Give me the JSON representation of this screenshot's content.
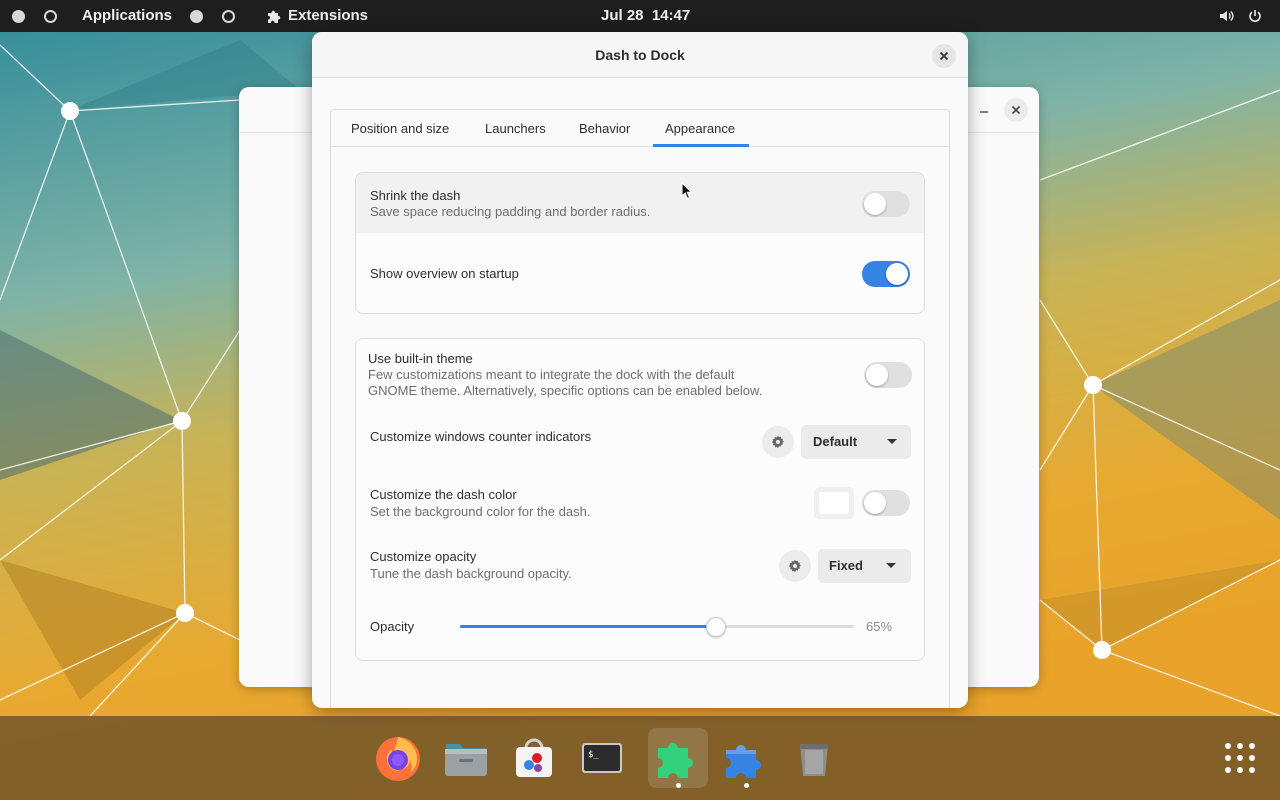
{
  "topbar": {
    "applications_label": "Applications",
    "extensions_label": "Extensions",
    "datetime": "Jul 28  14:47",
    "volume_icon": "volume-icon",
    "power_icon": "power-icon"
  },
  "dialog": {
    "title": "Dash to Dock",
    "tabs": [
      {
        "label": "Position and size"
      },
      {
        "label": "Launchers"
      },
      {
        "label": "Behavior"
      },
      {
        "label": "Appearance",
        "active": true
      }
    ],
    "shrink": {
      "title": "Shrink the dash",
      "subtitle": "Save space reducing padding and border radius.",
      "enabled": false
    },
    "overview": {
      "title": "Show overview on startup",
      "enabled": true
    },
    "builtin_theme": {
      "title": "Use built-in theme",
      "subtitle_line1": "Few customizations meant to integrate the dock with the default",
      "subtitle_line2": "GNOME theme. Alternatively, specific options can be enabled below.",
      "enabled": false
    },
    "counter": {
      "title": "Customize windows counter indicators",
      "value": "Default"
    },
    "dash_color": {
      "title": "Customize the dash color",
      "subtitle": "Set the background color for the dash.",
      "color": "#ffffff",
      "enabled": false
    },
    "opacity_mode": {
      "title": "Customize opacity",
      "subtitle": "Tune the dash background opacity.",
      "value": "Fixed"
    },
    "opacity": {
      "label": "Opacity",
      "value_text": "65%",
      "fraction": 0.65
    }
  },
  "colors": {
    "accent": "#3584e4",
    "topbar_bg": "#1e1e1e"
  },
  "dock": {
    "apps": [
      {
        "name": "firefox-icon",
        "active": false
      },
      {
        "name": "files-icon",
        "active": false
      },
      {
        "name": "software-icon",
        "active": false
      },
      {
        "name": "terminal-icon",
        "active": false
      },
      {
        "name": "extensions-green-icon",
        "active": true
      },
      {
        "name": "extensions-blue-icon",
        "active": false,
        "running": true
      },
      {
        "name": "trash-icon",
        "active": false
      }
    ],
    "app_grid_icon": "app-grid-icon"
  }
}
